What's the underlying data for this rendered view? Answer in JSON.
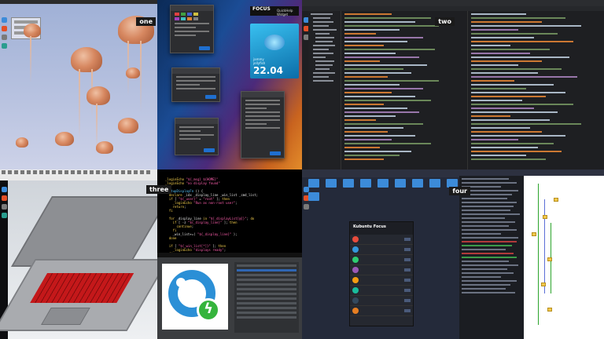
{
  "labels": {
    "q1": "one",
    "q2": "two",
    "q3": "three",
    "q4": "four"
  },
  "focus_widget": {
    "brand": "FOCUS",
    "subtitle": "QuickHelp Widget"
  },
  "release": {
    "codename_line1": "jammy",
    "codename_line2": "jellyfish",
    "version": "22.04"
  },
  "krita_icon": "lightning-bolt-icon",
  "store_window": {
    "title": "Kubuntu Focus"
  },
  "colors": {
    "accent_blue": "#2b8fd6",
    "accent_green": "#35b43c",
    "jelly_orange": "#d9855a",
    "keyboard_red": "#c4181a"
  }
}
